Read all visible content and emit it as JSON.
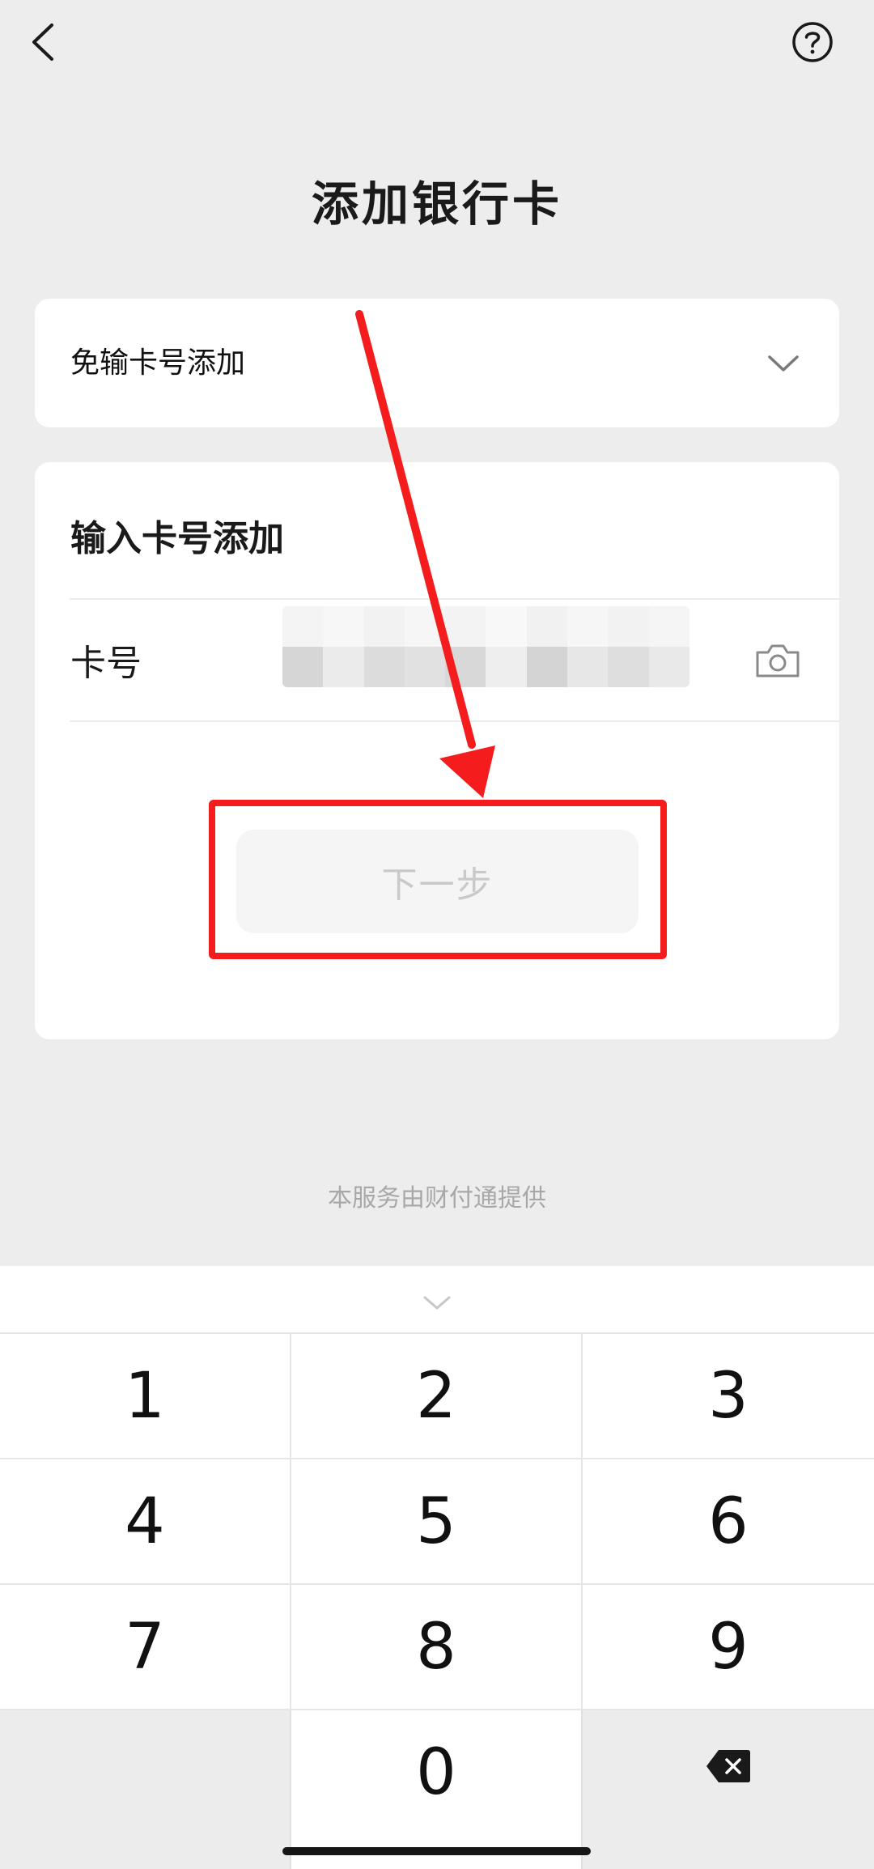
{
  "page": {
    "title": "添加银行卡"
  },
  "icons": {
    "back": "chevron-left-icon",
    "help": "help-circle-icon",
    "expand": "chevron-down-icon",
    "camera": "camera-icon",
    "keyboard_collapse": "chevron-down-icon",
    "backspace": "backspace-icon"
  },
  "quick_add": {
    "label": "免输卡号添加"
  },
  "manual_add": {
    "title": "输入卡号添加",
    "card_number_label": "卡号",
    "card_number_value": ""
  },
  "actions": {
    "next_label": "下一步"
  },
  "footer": {
    "service_note": "本服务由财付通提供"
  },
  "keyboard": {
    "keys": [
      "1",
      "2",
      "3",
      "4",
      "5",
      "6",
      "7",
      "8",
      "9",
      "0"
    ]
  },
  "colors": {
    "background": "#ededed",
    "card": "#ffffff",
    "annotation_red": "#f41c1c",
    "disabled_text": "#c9c9c9"
  }
}
